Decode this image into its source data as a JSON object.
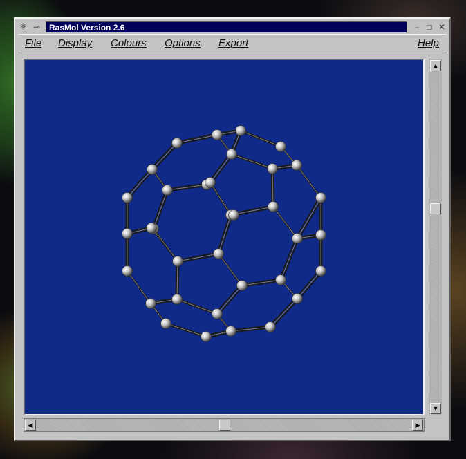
{
  "window": {
    "title": "RasMol Version 2.6",
    "icons": {
      "system": "molecule-icon",
      "pin": "pin-icon",
      "minimize": "minimize-icon",
      "maximize": "maximize-icon",
      "close": "close-icon"
    }
  },
  "menu": {
    "file": "File",
    "display": "Display",
    "colours": "Colours",
    "options": "Options",
    "export": "Export",
    "help": "Help"
  },
  "colors": {
    "canvas_background": "#102a8a",
    "title_background": "#00005a",
    "window_face": "#c3c3c3",
    "atom": "#c8c8c8",
    "bond": "#1a1a1a"
  },
  "scrollbars": {
    "vertical_thumb_fraction": 0.41,
    "horizontal_thumb_fraction": 0.51
  },
  "molecule": {
    "rendering": "ball-and-stick",
    "description_shape": "truncated-icosahedron"
  }
}
